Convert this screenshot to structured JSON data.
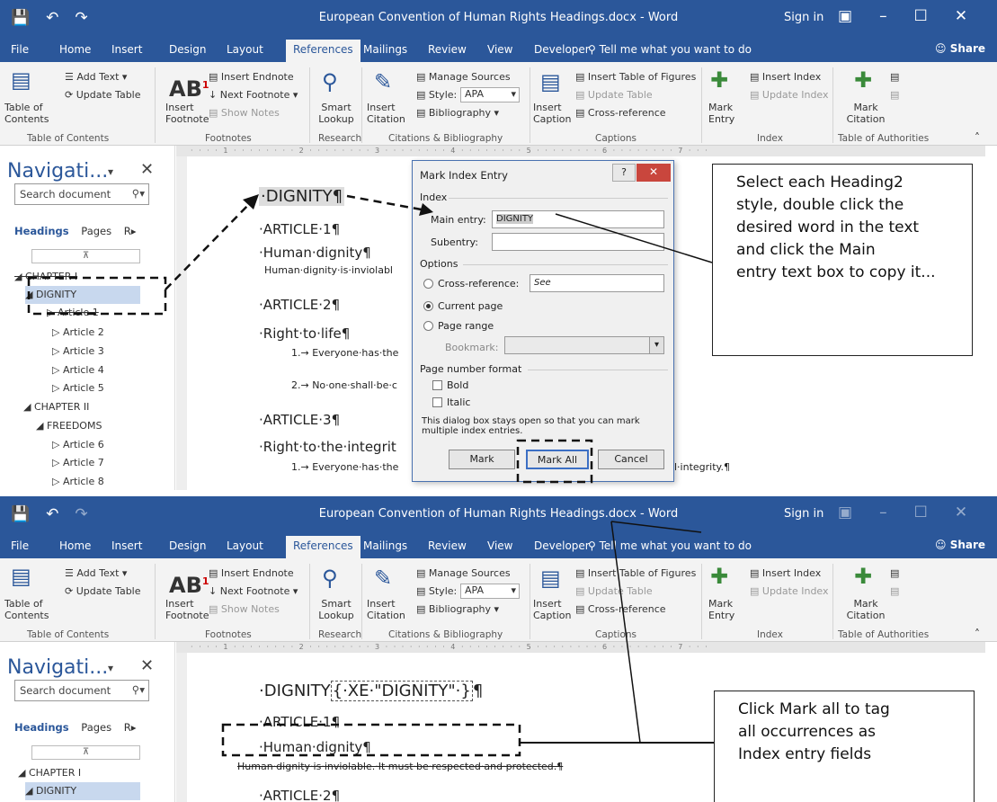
{
  "top": {
    "window_title": "European Convention of Human Rights Headings.docx - Word",
    "sign_in": "Sign in",
    "tabs": [
      "File",
      "Home",
      "Insert",
      "Design",
      "Layout",
      "References",
      "Mailings",
      "Review",
      "View",
      "Developer"
    ],
    "tell_me": "Tell me what you want to do",
    "share": "Share",
    "ribbon": {
      "toc": "Table of Contents",
      "add_text": "Add Text",
      "update_table": "Update Table",
      "insert_endnote": "Insert Endnote",
      "next_footnote": "Next Footnote",
      "insert_footnote": "Insert Footnote",
      "show_notes": "Show Notes",
      "smart_lookup": "Smart Lookup",
      "insert_citation": "Insert Citation",
      "manage_sources": "Manage Sources",
      "style_label": "Style:",
      "style_value": "APA",
      "bibliography": "Bibliography",
      "insert_caption": "Insert Caption",
      "insert_tof": "Insert Table of Figures",
      "update_table2": "Update Table",
      "cross_ref": "Cross-reference",
      "mark_entry": "Mark Entry",
      "insert_index": "Insert Index",
      "update_index": "Update Index",
      "mark_citation": "Mark Citation",
      "groups": [
        "Table of Contents",
        "Footnotes",
        "Research",
        "Citations & Bibliography",
        "Captions",
        "Index",
        "Table of Authorities"
      ]
    },
    "nav": {
      "title": "Navigati...",
      "search_placeholder": "Search document",
      "tab_headings": "Headings",
      "tab_pages": "Pages",
      "tab_results": "R",
      "tree": [
        "CHAPTER I",
        "DIGNITY",
        "Article 1",
        "Article 2",
        "Article 3",
        "Article 4",
        "Article 5",
        "CHAPTER II",
        "FREEDOMS",
        "Article 6",
        "Article 7",
        "Article 8"
      ]
    },
    "doc": {
      "p1": "DIGNITY¶",
      "p2": "ARTICLE·1¶",
      "p3": "Human·dignity¶",
      "p4": "Human·dignity·is·inviolabl",
      "p5": "ARTICLE·2¶",
      "p6": "Right·to·life¶",
      "p7": "1.→ Everyone·has·the",
      "p8": "2.→ No·one·shall·be·c",
      "p9": "ARTICLE·3¶",
      "p10": "Right·to·the·integrit",
      "p11": "1.→ Everyone·has·the",
      "p12": "l·integrity.¶"
    },
    "dialog": {
      "title": "Mark Index Entry",
      "index_label": "Index",
      "main_entry_label": "Main entry:",
      "main_entry_value": "DIGNITY",
      "subentry_label": "Subentry:",
      "options_label": "Options",
      "cross_ref_label": "Cross-reference:",
      "cross_ref_value": "See",
      "current_page": "Current page",
      "page_range": "Page range",
      "bookmark": "Bookmark:",
      "page_format": "Page number format",
      "bold": "Bold",
      "italic": "Italic",
      "note": "This dialog box stays open so that you can mark multiple index entries.",
      "mark": "Mark",
      "mark_all": "Mark All",
      "cancel": "Cancel"
    },
    "callout": "Select each Heading2\nstyle, double click the\ndesired word in the text\nand click the Main\nentry text box to copy it..."
  },
  "bottom": {
    "doc": {
      "p1a": "DIGNITY",
      "p1b": "{·XE·\"DIGNITY\"·}",
      "p1c": "¶",
      "p2": "ARTICLE·1¶",
      "p3": "Human·dignity¶",
      "p4": "Human·dignity·is·inviolable.·It·must·be·respected·and·protected.¶",
      "p5": "ARTICLE·2¶"
    },
    "callout": "Click Mark all to tag\nall occurrences as\nIndex entry fields"
  }
}
